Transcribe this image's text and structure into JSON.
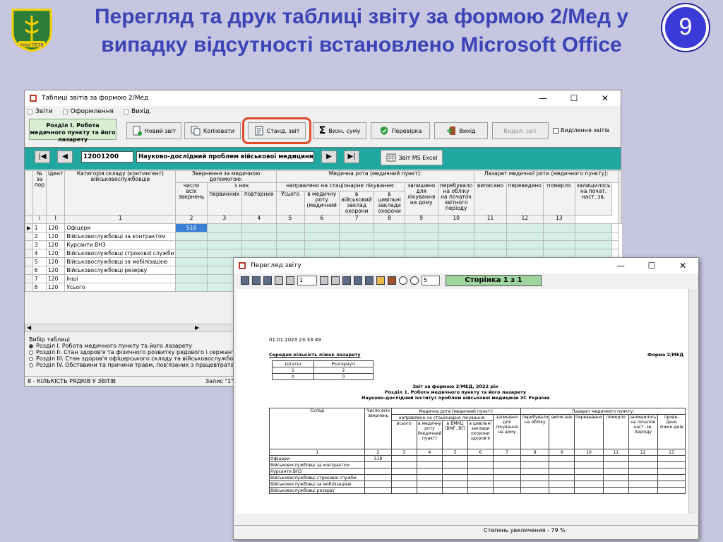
{
  "slide": {
    "title": "Перегляд та друк таблиці звіту за формою 2/Мед у випадку відсутності встановлено Microsoft Office",
    "page_number": "9",
    "logo_text": "Нашi ПЕЗВ"
  },
  "main_window": {
    "title": "Таблиці звітів за формою 2/Мед",
    "menu": [
      "Звіти",
      "Оформлення",
      "Вихід"
    ],
    "section_label": "Розділ І. Робота медичного пункту та його лазарету",
    "buttons": {
      "new_report": "Новий звіт",
      "copy": "Копіювати",
      "standard_report": "Станд. звіт",
      "sum": "Визн. суму",
      "check": "Перевірка",
      "exit": "Вихід",
      "delete_report": "Видал. звіт",
      "select_reports": "Виділення звітів",
      "ms_excel": "Звіт MS Excel"
    },
    "nav": {
      "code": "12001200",
      "organization": "Науково-дослідний проблем військової медицини інстит"
    },
    "table": {
      "headers": {
        "num": "№ за пор",
        "id": "Ідент",
        "category": "Категорія складу (контингент) військовослужбовців",
        "visits_group": "Звернення за медичною допомогою:",
        "visits_all": "число всіх звернень",
        "of_which": "з них",
        "primary": "первинних",
        "repeat": "повторних",
        "med_company": "Медична рота (медичний пункт):",
        "inpatient": "направлено на стаціонарне лікування:",
        "total": "Усього",
        "to_med_company": "в медичну роту (медичний",
        "to_mil_facility": "в військовий заклад охорони",
        "to_civil_facility": "в цивільні заклади охорони",
        "left_home": "залишено для лікування на дому",
        "lazaret_group": "Лазарет медичної роти (медичного пункту):",
        "remained_start": "перебувало на обліку на початок звітного періоду",
        "discharged": "виписано",
        "transferred": "переведено",
        "died": "померло",
        "remained_end": "залишилось на почат. наст. зв."
      },
      "index_row": [
        "і",
        "І",
        "1",
        "2",
        "3",
        "4",
        "5",
        "6",
        "7",
        "8",
        "9",
        "10",
        "11",
        "12",
        "13",
        "14"
      ],
      "rows": [
        {
          "num": "1",
          "id": "120",
          "category": "Офіцери",
          "value": "518"
        },
        {
          "num": "2",
          "id": "120",
          "category": "Військовослужбовці за контрактом",
          "value": ""
        },
        {
          "num": "3",
          "id": "120",
          "category": "Курсанти ВНЗ",
          "value": ""
        },
        {
          "num": "4",
          "id": "120",
          "category": "Військовослужбовці строкової служби",
          "value": ""
        },
        {
          "num": "5",
          "id": "120",
          "category": "Військовослужбовці за мобілізацією",
          "value": ""
        },
        {
          "num": "6",
          "id": "120",
          "category": "Військовослужбовці резерву",
          "value": ""
        },
        {
          "num": "7",
          "id": "120",
          "category": "Інші",
          "value": ""
        },
        {
          "num": "8",
          "id": "120",
          "category": "Усього",
          "value": ""
        }
      ]
    },
    "table_choice": {
      "label": "Вибір таблиці",
      "options": [
        "Розділ І. Робота медичного пункту та його лазарету",
        "Розділ ІІ. Стан здоров'я та фізичного розвитку рядового і сержантського с",
        "Розділ ІІІ. Стан здоров'я офіцерського складу та військовослужбовців за к",
        "Розділ IV. Обставини та причини травм, пов'язаних з працевтратами"
      ]
    },
    "status_left": "8 - КІЛЬКІСТЬ РЯДКІВ У ЗВІТІВ",
    "status_right": "Запис \"1\""
  },
  "preview_window": {
    "title": "Перегляд звіту",
    "page_input": "1",
    "zoom_input": "5",
    "page_label": "Сторінка 1 з 1",
    "status": "Степень увеличения - 79 %",
    "paper": {
      "datetime": "01.01.2023 23:33:49",
      "avg_title": "Середня кількість ліжок лазарету",
      "form": "Форма 2/МЕД",
      "avg_headers": [
        "Штатні",
        "Розгорнуті"
      ],
      "avg_index": [
        "1",
        "2"
      ],
      "avg_values": [
        "0",
        "0"
      ],
      "report_title_1": "Звіт за формою 2/МЕД, 2022 рік",
      "report_title_2": "Розділ 1. Робота медичного пункту та його лазарету",
      "report_title_3": "Науково-дослідний інститут проблем військової медицини ЗС України",
      "h_composition": "Склад",
      "h_all_visits": "Число всіх звернень",
      "h_med_company": "Медична рота (медичний пункт):",
      "h_lazaret": "Лазарет медичного пункту:",
      "h_inpatient": "направлено на стаціонарне лікування:",
      "h_total": "всього",
      "h_to_company": "в медичну роту (медичний пункт)",
      "h_vmkc": "в ВМКЦ (ВМГ, ВГ)",
      "h_civil": "в цивільні заклади охорони здоров'я",
      "h_home": "залишено для лікування на дому",
      "h_on_record": "перебувало на обліку",
      "h_discharged": "виписано",
      "h_transferred": "переведено",
      "h_died": "померло",
      "h_remain": "залишилось на початок наст. зв. періоду",
      "h_beddays": "прове-дено ліжко-днів",
      "index": [
        "1",
        "2",
        "3",
        "4",
        "5",
        "6",
        "7",
        "8",
        "9",
        "10",
        "11",
        "12",
        "13"
      ],
      "rows": [
        {
          "name": "Офіцери",
          "value": "518"
        },
        {
          "name": "Військовослужбовці за контрактом",
          "value": ""
        },
        {
          "name": "Курсанти ВНЗ",
          "value": ""
        },
        {
          "name": "Військовослужбовці строкової служби",
          "value": ""
        },
        {
          "name": "Військовослужбовці за мобілізацією",
          "value": ""
        },
        {
          "name": "Військовослужбовці резерву",
          "value": ""
        }
      ]
    }
  },
  "colors": {
    "title": "#3b44b6",
    "highlight": "#e04a2a",
    "teal": "#20a8a0",
    "badge": "#3a3ad8"
  }
}
